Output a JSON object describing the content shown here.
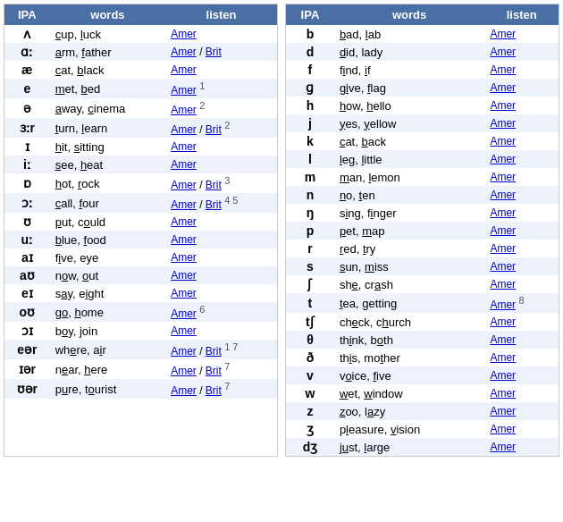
{
  "tables": [
    {
      "id": "vowels",
      "headers": [
        "IPA",
        "words",
        "listen"
      ],
      "rows": [
        {
          "ipa": "ʌ",
          "words": "cup, luck",
          "words_underline": [],
          "amer": true,
          "brit": false,
          "notes": ""
        },
        {
          "ipa": "ɑː",
          "words": "arm, father",
          "words_underline": [],
          "amer": true,
          "brit": true,
          "notes": ""
        },
        {
          "ipa": "æ",
          "words": "cat, black",
          "words_underline": [],
          "amer": true,
          "brit": false,
          "notes": ""
        },
        {
          "ipa": "e",
          "words": "met, bed",
          "words_underline": [],
          "amer": true,
          "brit": false,
          "notes": "1"
        },
        {
          "ipa": "ə",
          "words": "away, cinema",
          "words_underline": [],
          "amer": true,
          "brit": false,
          "notes": "2"
        },
        {
          "ipa": "ɜːr",
          "words": "turn, learn",
          "words_underline": [],
          "amer": true,
          "brit": true,
          "notes": "2"
        },
        {
          "ipa": "ɪ",
          "words": "hit, sitting",
          "words_underline": [],
          "amer": true,
          "brit": false,
          "notes": ""
        },
        {
          "ipa": "iː",
          "words": "see, heat",
          "words_underline": [],
          "amer": true,
          "brit": false,
          "notes": ""
        },
        {
          "ipa": "ɒ",
          "words": "hot, rock",
          "words_underline": [],
          "amer": true,
          "brit": true,
          "notes": "3"
        },
        {
          "ipa": "ɔː",
          "words": "call, four",
          "words_underline": [],
          "amer": true,
          "brit": true,
          "notes": "4 5"
        },
        {
          "ipa": "ʊ",
          "words": "put, could",
          "words_underline": [],
          "amer": true,
          "brit": false,
          "notes": ""
        },
        {
          "ipa": "uː",
          "words": "blue, food",
          "words_underline": [],
          "amer": true,
          "brit": false,
          "notes": ""
        },
        {
          "ipa": "aɪ",
          "words": "five, eye",
          "words_underline": [],
          "amer": true,
          "brit": false,
          "notes": ""
        },
        {
          "ipa": "aʊ",
          "words": "now, out",
          "words_underline": [],
          "amer": true,
          "brit": false,
          "notes": ""
        },
        {
          "ipa": "eɪ",
          "words": "say, eight",
          "words_underline": [],
          "amer": true,
          "brit": false,
          "notes": ""
        },
        {
          "ipa": "oʊ",
          "words": "go, home",
          "words_underline": [],
          "amer": true,
          "brit": false,
          "notes": "6"
        },
        {
          "ipa": "ɔɪ",
          "words": "boy, join",
          "words_underline": [],
          "amer": true,
          "brit": false,
          "notes": ""
        },
        {
          "ipa": "eər",
          "words": "where, air",
          "words_underline": [],
          "amer": true,
          "brit": true,
          "notes": "1 7"
        },
        {
          "ipa": "ɪər",
          "words": "near, here",
          "words_underline": [],
          "amer": true,
          "brit": true,
          "notes": "7"
        },
        {
          "ipa": "ʊər",
          "words": "pure, tourist",
          "words_underline": [],
          "amer": true,
          "brit": true,
          "notes": "7"
        }
      ]
    },
    {
      "id": "consonants",
      "headers": [
        "IPA",
        "words",
        "listen"
      ],
      "rows": [
        {
          "ipa": "b",
          "words": "bad, lab",
          "amer": true,
          "brit": false,
          "notes": ""
        },
        {
          "ipa": "d",
          "words": "did, lady",
          "amer": true,
          "brit": false,
          "notes": ""
        },
        {
          "ipa": "f",
          "words": "find, if",
          "amer": true,
          "brit": false,
          "notes": ""
        },
        {
          "ipa": "ɡ",
          "words": "give, flag",
          "amer": true,
          "brit": false,
          "notes": ""
        },
        {
          "ipa": "h",
          "words": "how, hello",
          "amer": true,
          "brit": false,
          "notes": ""
        },
        {
          "ipa": "j",
          "words": "yes, yellow",
          "amer": true,
          "brit": false,
          "notes": ""
        },
        {
          "ipa": "k",
          "words": "cat, back",
          "amer": true,
          "brit": false,
          "notes": ""
        },
        {
          "ipa": "l",
          "words": "leg, little",
          "amer": true,
          "brit": false,
          "notes": ""
        },
        {
          "ipa": "m",
          "words": "man, lemon",
          "amer": true,
          "brit": false,
          "notes": ""
        },
        {
          "ipa": "n",
          "words": "no, ten",
          "amer": true,
          "brit": false,
          "notes": ""
        },
        {
          "ipa": "ŋ",
          "words": "sing, finger",
          "amer": true,
          "brit": false,
          "notes": ""
        },
        {
          "ipa": "p",
          "words": "pet, map",
          "amer": true,
          "brit": false,
          "notes": ""
        },
        {
          "ipa": "r",
          "words": "red, try",
          "amer": true,
          "brit": false,
          "notes": ""
        },
        {
          "ipa": "s",
          "words": "sun, miss",
          "amer": true,
          "brit": false,
          "notes": ""
        },
        {
          "ipa": "ʃ",
          "words": "she, crash",
          "amer": true,
          "brit": false,
          "notes": ""
        },
        {
          "ipa": "t",
          "words": "tea, getting",
          "amer": true,
          "brit": false,
          "notes": "8"
        },
        {
          "ipa": "tʃ",
          "words": "check, church",
          "amer": true,
          "brit": false,
          "notes": ""
        },
        {
          "ipa": "θ",
          "words": "think, both",
          "amer": true,
          "brit": false,
          "notes": ""
        },
        {
          "ipa": "ð",
          "words": "this, mother",
          "amer": true,
          "brit": false,
          "notes": ""
        },
        {
          "ipa": "v",
          "words": "voice, five",
          "amer": true,
          "brit": false,
          "notes": ""
        },
        {
          "ipa": "w",
          "words": "wet, window",
          "amer": true,
          "brit": false,
          "notes": ""
        },
        {
          "ipa": "z",
          "words": "zoo, lazy",
          "amer": true,
          "brit": false,
          "notes": ""
        },
        {
          "ipa": "ʒ",
          "words": "pleasure, vision",
          "amer": true,
          "brit": false,
          "notes": ""
        },
        {
          "ipa": "dʒ",
          "words": "just, large",
          "amer": true,
          "brit": false,
          "notes": ""
        }
      ]
    }
  ],
  "labels": {
    "amer": "Amer",
    "brit": "Brit",
    "divider": " / "
  }
}
